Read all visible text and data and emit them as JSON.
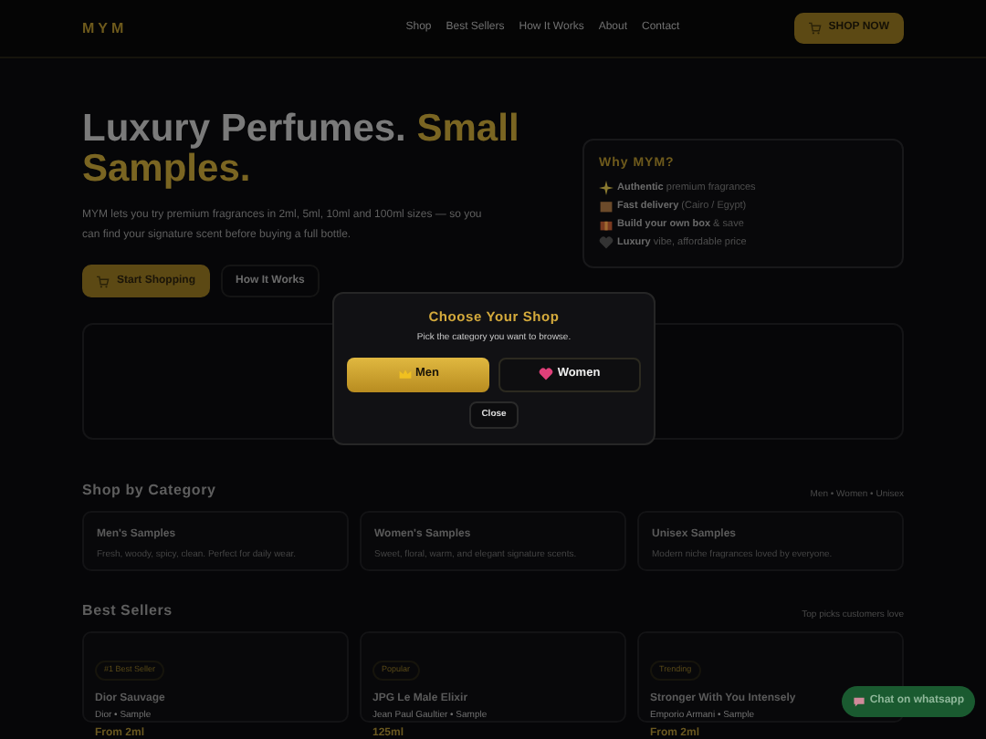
{
  "nav": {
    "logo": "MYM",
    "links": [
      "Shop",
      "Best Sellers",
      "How It Works",
      "About",
      "Contact"
    ],
    "cta": "SHOP NOW"
  },
  "hero": {
    "title": "Luxury Perfumes.",
    "title_accent": "Small Samples.",
    "text": "MYM lets you try premium fragrances in 2ml, 5ml, 10ml and 100ml sizes — so you can find your signature scent before buying a full bottle.",
    "primary": "Start Shopping",
    "secondary": "How It Works"
  },
  "why": {
    "title": "Why MYM?",
    "items": [
      {
        "kind": "sparkle",
        "text": "**Authentic** premium fragrances"
      },
      {
        "kind": "box",
        "text": "**Fast delivery** (Cairo / Egypt)"
      },
      {
        "kind": "gift",
        "text": "**Build your own box** & save"
      },
      {
        "kind": "heart",
        "text": "**Luxury** vibe, affordable price"
      }
    ]
  },
  "modal": {
    "title": "Choose Your Shop",
    "subtitle": "Pick the category you want to browse.",
    "options": [
      {
        "kind": "crown",
        "label": "Men",
        "selected": true
      },
      {
        "kind": "heart",
        "label": "Women",
        "selected": false
      }
    ],
    "close": "Close"
  },
  "categories": {
    "title": "Shop by Category",
    "note": "Men • Women • Unisex",
    "cards": [
      {
        "title": "Men's Samples",
        "text": "Fresh, woody, spicy, clean. Perfect for daily wear."
      },
      {
        "title": "Women's Samples",
        "text": "Sweet, floral, warm, and elegant signature scents."
      },
      {
        "title": "Unisex Samples",
        "text": "Modern niche fragrances loved by everyone."
      }
    ]
  },
  "best": {
    "title": "Best Sellers",
    "note": "Top picks customers love",
    "cards": [
      {
        "badge": "#1 Best Seller",
        "name": "Dior Sauvage",
        "meta": "Dior • Sample",
        "price": "From 2ml"
      },
      {
        "badge": "Popular",
        "name": "JPG Le Male Elixir",
        "meta": "Jean Paul Gaultier • Sample",
        "price": "125ml"
      },
      {
        "badge": "Trending",
        "name": "Stronger With You Intensely",
        "meta": "Emporio Armani • Sample",
        "price": "From 2ml"
      }
    ]
  },
  "chat": "Chat on whatsapp"
}
